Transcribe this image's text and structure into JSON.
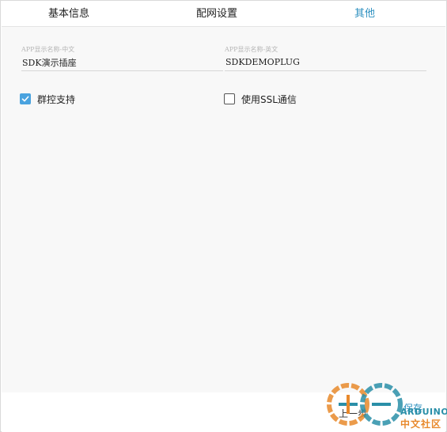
{
  "tabs": [
    {
      "label": "基本信息"
    },
    {
      "label": "配网设置"
    },
    {
      "label": "其他",
      "active": true
    }
  ],
  "form": {
    "name_cn": {
      "label": "APP显示名称-中文",
      "value": "SDK演示插座"
    },
    "name_en": {
      "label": "APP显示名称-英文",
      "value": "SDKDEMOPLUG"
    }
  },
  "options": {
    "group_control": {
      "label": "群控支持",
      "checked": true
    },
    "ssl": {
      "label": "使用SSL通信",
      "checked": false
    }
  },
  "footer": {
    "prev_label": "上一步",
    "save_label": "保存"
  },
  "watermark": {
    "line1": "ARDUINO",
    "line2": "中文社区"
  },
  "colors": {
    "accent": "#2b8fbf",
    "checkbox": "#4aa3df",
    "content_bg": "#f8f8f8"
  }
}
